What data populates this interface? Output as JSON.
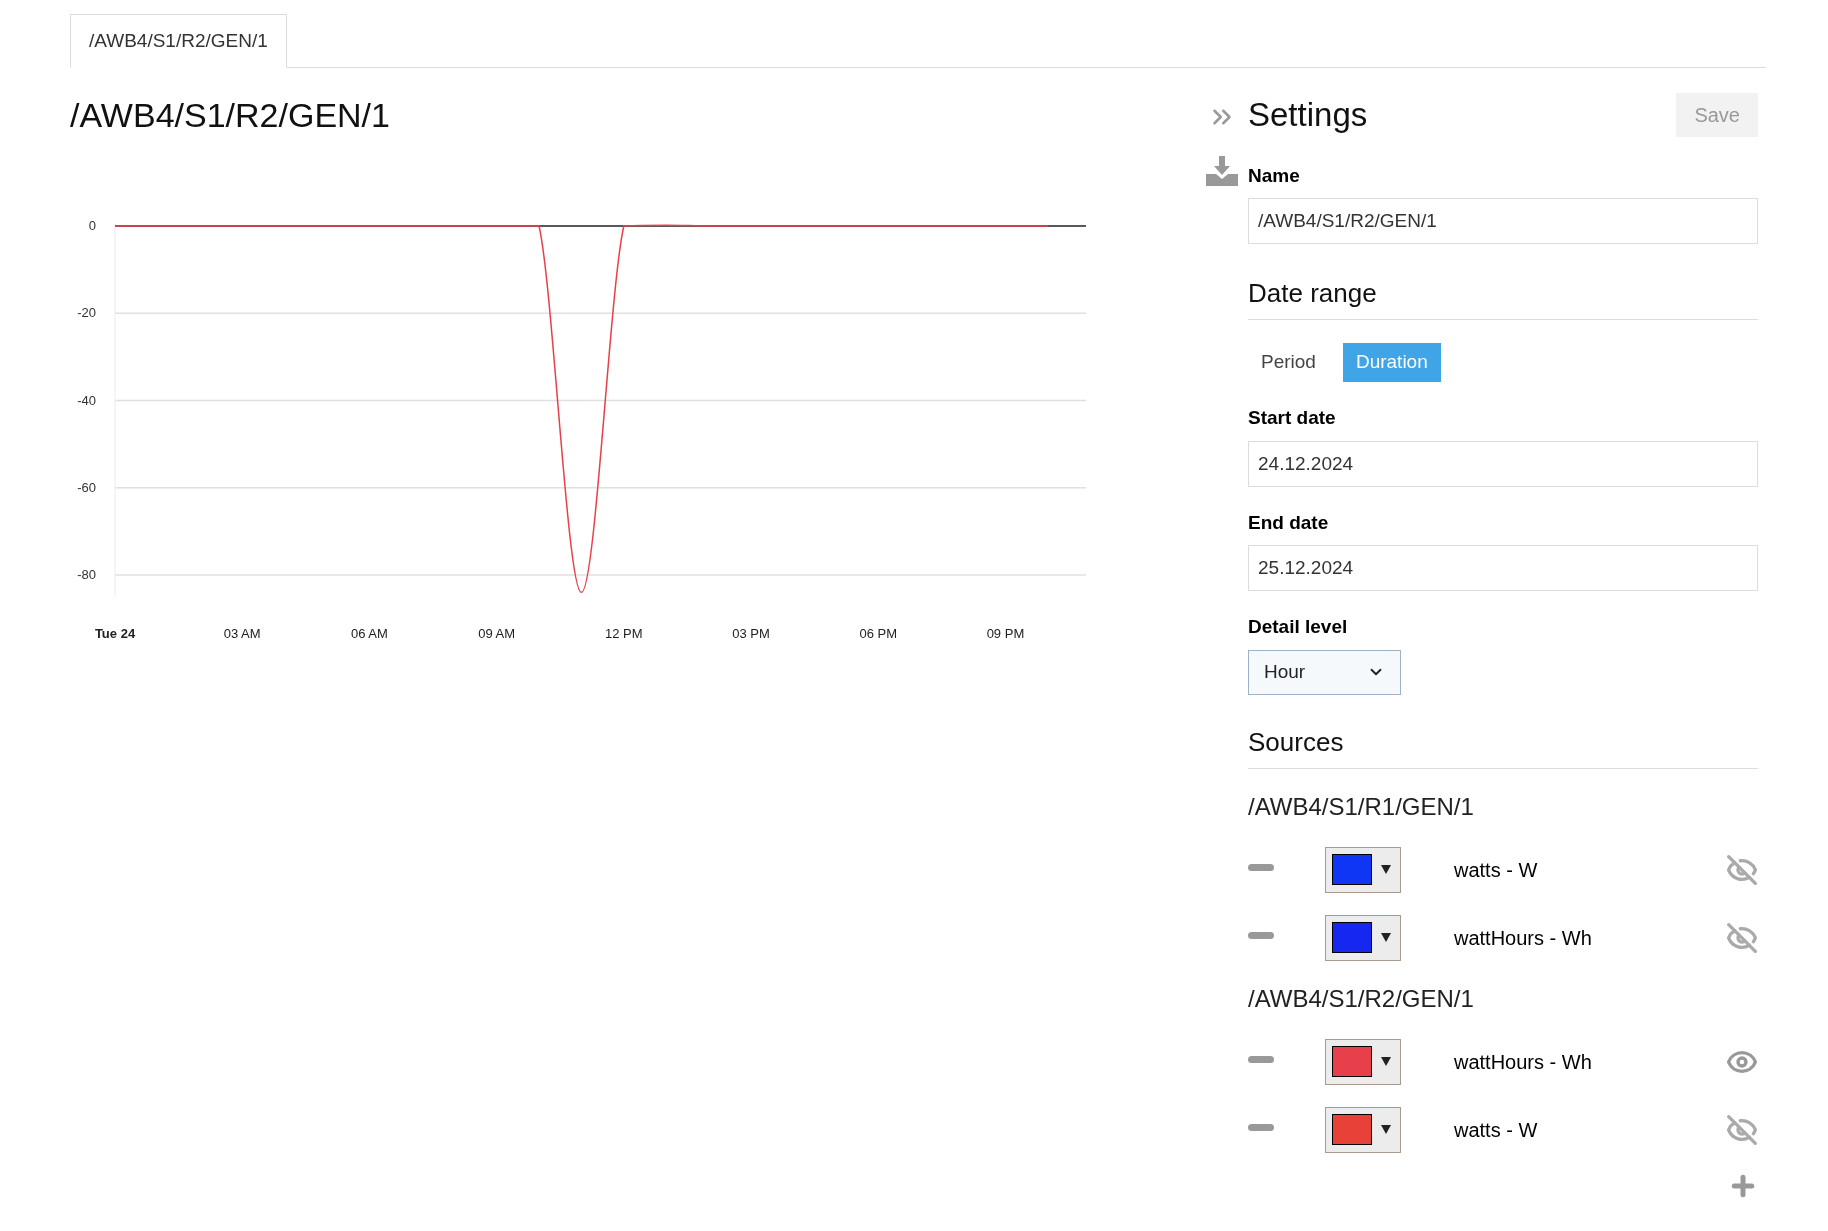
{
  "tabs": [
    {
      "label": "/AWB4/S1/R2/GEN/1",
      "selected": true
    }
  ],
  "title": "/AWB4/S1/R2/GEN/1",
  "chart_data": {
    "type": "line",
    "grid": true,
    "xlim": [
      "2024-12-24T00:00",
      "2024-12-24T22:54"
    ],
    "ylim": [
      -85,
      0.5
    ],
    "x": [
      "2024-12-24T00:00",
      "2024-12-24T01:00",
      "2024-12-24T02:00",
      "2024-12-24T03:00",
      "2024-12-24T04:00",
      "2024-12-24T05:00",
      "2024-12-24T06:00",
      "2024-12-24T07:00",
      "2024-12-24T08:00",
      "2024-12-24T09:00",
      "2024-12-24T10:00",
      "2024-12-24T11:00",
      "2024-12-24T12:00",
      "2024-12-24T13:00",
      "2024-12-24T14:00",
      "2024-12-24T15:00",
      "2024-12-24T16:00",
      "2024-12-24T17:00",
      "2024-12-24T18:00",
      "2024-12-24T19:00",
      "2024-12-24T20:00",
      "2024-12-24T21:00",
      "2024-12-24T22:00"
    ],
    "xticks": [
      {
        "value": "2024-12-24T00:00",
        "label": "Tue 24"
      },
      {
        "value": "2024-12-24T03:00",
        "label": "03 AM"
      },
      {
        "value": "2024-12-24T06:00",
        "label": "06 AM"
      },
      {
        "value": "2024-12-24T09:00",
        "label": "09 AM"
      },
      {
        "value": "2024-12-24T12:00",
        "label": "12 PM"
      },
      {
        "value": "2024-12-24T15:00",
        "label": "03 PM"
      },
      {
        "value": "2024-12-24T18:00",
        "label": "06 PM"
      },
      {
        "value": "2024-12-24T21:00",
        "label": "09 PM"
      }
    ],
    "yticks": [
      0,
      -20,
      -40,
      -60,
      -80
    ],
    "series": [
      {
        "color": "#e8404a",
        "values": [
          0,
          0,
          0,
          0,
          0,
          0,
          0,
          0,
          0,
          0,
          0,
          -84,
          0,
          0.2,
          0,
          0,
          0,
          0,
          0,
          0,
          0,
          0,
          0
        ]
      }
    ]
  },
  "settings": {
    "title": "Settings",
    "save_button": {
      "label": "Save",
      "disabled": true
    },
    "name": {
      "label": "Name",
      "value": "/AWB4/S1/R2/GEN/1"
    },
    "date_range": {
      "heading": "Date range",
      "modes": [
        {
          "label": "Period",
          "selected": false
        },
        {
          "label": "Duration",
          "selected": true
        }
      ],
      "start_date": {
        "label": "Start date",
        "value": "24.12.2024"
      },
      "end_date": {
        "label": "End date",
        "value": "25.12.2024"
      },
      "detail_level": {
        "label": "Detail level",
        "value": "Hour"
      }
    },
    "sources": {
      "heading": "Sources",
      "groups": [
        {
          "name": "/AWB4/S1/R1/GEN/1",
          "items": [
            {
              "label": "watts - W",
              "color": "#1036f5",
              "visible": false
            },
            {
              "label": "wattHours - Wh",
              "color": "#1628f0",
              "visible": false
            }
          ]
        },
        {
          "name": "/AWB4/S1/R2/GEN/1",
          "items": [
            {
              "label": "wattHours - Wh",
              "color": "#e8404a",
              "visible": true
            },
            {
              "label": "watts - W",
              "color": "#e84238",
              "visible": false
            }
          ]
        }
      ]
    }
  }
}
